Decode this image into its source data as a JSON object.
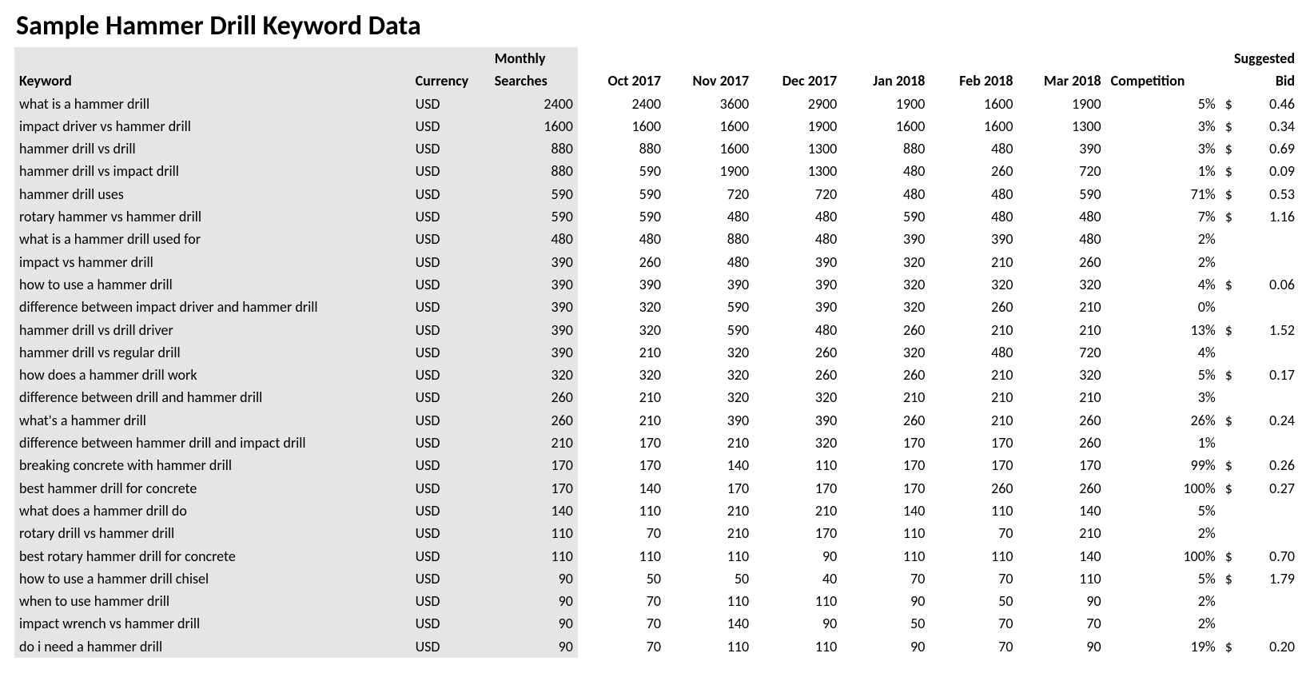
{
  "title": "Sample Hammer Drill Keyword Data",
  "headers": {
    "keyword": "Keyword",
    "currency": "Currency",
    "monthly_searches_l1": "Monthly",
    "monthly_searches_l2": "Searches",
    "months": [
      "Oct 2017",
      "Nov 2017",
      "Dec 2017",
      "Jan 2018",
      "Feb 2018",
      "Mar 2018"
    ],
    "competition": "Competition",
    "suggested_l1": "Suggested",
    "suggested_l2": "Bid"
  },
  "rows": [
    {
      "keyword": "what is a hammer drill",
      "currency": "USD",
      "monthly": "2400",
      "m": [
        "2400",
        "3600",
        "2900",
        "1900",
        "1600",
        "1900"
      ],
      "competition": "5%",
      "bid": "0.46"
    },
    {
      "keyword": "impact driver vs hammer drill",
      "currency": "USD",
      "monthly": "1600",
      "m": [
        "1600",
        "1600",
        "1900",
        "1600",
        "1600",
        "1300"
      ],
      "competition": "3%",
      "bid": "0.34"
    },
    {
      "keyword": "hammer drill vs drill",
      "currency": "USD",
      "monthly": "880",
      "m": [
        "880",
        "1600",
        "1300",
        "880",
        "480",
        "390"
      ],
      "competition": "3%",
      "bid": "0.69"
    },
    {
      "keyword": "hammer drill vs impact drill",
      "currency": "USD",
      "monthly": "880",
      "m": [
        "590",
        "1900",
        "1300",
        "480",
        "260",
        "720"
      ],
      "competition": "1%",
      "bid": "0.09"
    },
    {
      "keyword": "hammer drill uses",
      "currency": "USD",
      "monthly": "590",
      "m": [
        "590",
        "720",
        "720",
        "480",
        "480",
        "590"
      ],
      "competition": "71%",
      "bid": "0.53"
    },
    {
      "keyword": "rotary hammer vs hammer drill",
      "currency": "USD",
      "monthly": "590",
      "m": [
        "590",
        "480",
        "480",
        "590",
        "480",
        "480"
      ],
      "competition": "7%",
      "bid": "1.16"
    },
    {
      "keyword": "what is a hammer drill used for",
      "currency": "USD",
      "monthly": "480",
      "m": [
        "480",
        "880",
        "480",
        "390",
        "390",
        "480"
      ],
      "competition": "2%",
      "bid": ""
    },
    {
      "keyword": "impact vs hammer drill",
      "currency": "USD",
      "monthly": "390",
      "m": [
        "260",
        "480",
        "390",
        "320",
        "210",
        "260"
      ],
      "competition": "2%",
      "bid": ""
    },
    {
      "keyword": "how to use a hammer drill",
      "currency": "USD",
      "monthly": "390",
      "m": [
        "390",
        "390",
        "390",
        "320",
        "320",
        "320"
      ],
      "competition": "4%",
      "bid": "0.06"
    },
    {
      "keyword": "difference between impact driver and hammer drill",
      "currency": "USD",
      "monthly": "390",
      "m": [
        "320",
        "590",
        "390",
        "320",
        "260",
        "210"
      ],
      "competition": "0%",
      "bid": ""
    },
    {
      "keyword": "hammer drill vs drill driver",
      "currency": "USD",
      "monthly": "390",
      "m": [
        "320",
        "590",
        "480",
        "260",
        "210",
        "210"
      ],
      "competition": "13%",
      "bid": "1.52"
    },
    {
      "keyword": "hammer drill vs regular drill",
      "currency": "USD",
      "monthly": "390",
      "m": [
        "210",
        "320",
        "260",
        "320",
        "480",
        "720"
      ],
      "competition": "4%",
      "bid": ""
    },
    {
      "keyword": "how does a hammer drill work",
      "currency": "USD",
      "monthly": "320",
      "m": [
        "320",
        "320",
        "260",
        "260",
        "210",
        "320"
      ],
      "competition": "5%",
      "bid": "0.17"
    },
    {
      "keyword": "difference between drill and hammer drill",
      "currency": "USD",
      "monthly": "260",
      "m": [
        "210",
        "320",
        "320",
        "210",
        "210",
        "210"
      ],
      "competition": "3%",
      "bid": ""
    },
    {
      "keyword": "what's a hammer drill",
      "currency": "USD",
      "monthly": "260",
      "m": [
        "210",
        "390",
        "390",
        "260",
        "210",
        "260"
      ],
      "competition": "26%",
      "bid": "0.24"
    },
    {
      "keyword": "difference between hammer drill and impact drill",
      "currency": "USD",
      "monthly": "210",
      "m": [
        "170",
        "210",
        "320",
        "170",
        "170",
        "260"
      ],
      "competition": "1%",
      "bid": ""
    },
    {
      "keyword": "breaking concrete with hammer drill",
      "currency": "USD",
      "monthly": "170",
      "m": [
        "170",
        "140",
        "110",
        "170",
        "170",
        "170"
      ],
      "competition": "99%",
      "bid": "0.26"
    },
    {
      "keyword": "best hammer drill for concrete",
      "currency": "USD",
      "monthly": "170",
      "m": [
        "140",
        "170",
        "170",
        "170",
        "260",
        "260"
      ],
      "competition": "100%",
      "bid": "0.27"
    },
    {
      "keyword": "what does a hammer drill do",
      "currency": "USD",
      "monthly": "140",
      "m": [
        "110",
        "210",
        "210",
        "140",
        "110",
        "140"
      ],
      "competition": "5%",
      "bid": ""
    },
    {
      "keyword": "rotary drill vs hammer drill",
      "currency": "USD",
      "monthly": "110",
      "m": [
        "70",
        "210",
        "170",
        "110",
        "70",
        "210"
      ],
      "competition": "2%",
      "bid": ""
    },
    {
      "keyword": "best rotary hammer drill for concrete",
      "currency": "USD",
      "monthly": "110",
      "m": [
        "110",
        "110",
        "90",
        "110",
        "110",
        "140"
      ],
      "competition": "100%",
      "bid": "0.70"
    },
    {
      "keyword": "how to use a hammer drill chisel",
      "currency": "USD",
      "monthly": "90",
      "m": [
        "50",
        "50",
        "40",
        "70",
        "70",
        "110"
      ],
      "competition": "5%",
      "bid": "1.79"
    },
    {
      "keyword": "when to use hammer drill",
      "currency": "USD",
      "monthly": "90",
      "m": [
        "70",
        "110",
        "110",
        "90",
        "50",
        "90"
      ],
      "competition": "2%",
      "bid": ""
    },
    {
      "keyword": "impact wrench vs hammer drill",
      "currency": "USD",
      "monthly": "90",
      "m": [
        "70",
        "140",
        "90",
        "50",
        "70",
        "70"
      ],
      "competition": "2%",
      "bid": ""
    },
    {
      "keyword": "do i need a hammer drill",
      "currency": "USD",
      "monthly": "90",
      "m": [
        "70",
        "110",
        "110",
        "90",
        "70",
        "90"
      ],
      "competition": "19%",
      "bid": "0.20"
    }
  ]
}
